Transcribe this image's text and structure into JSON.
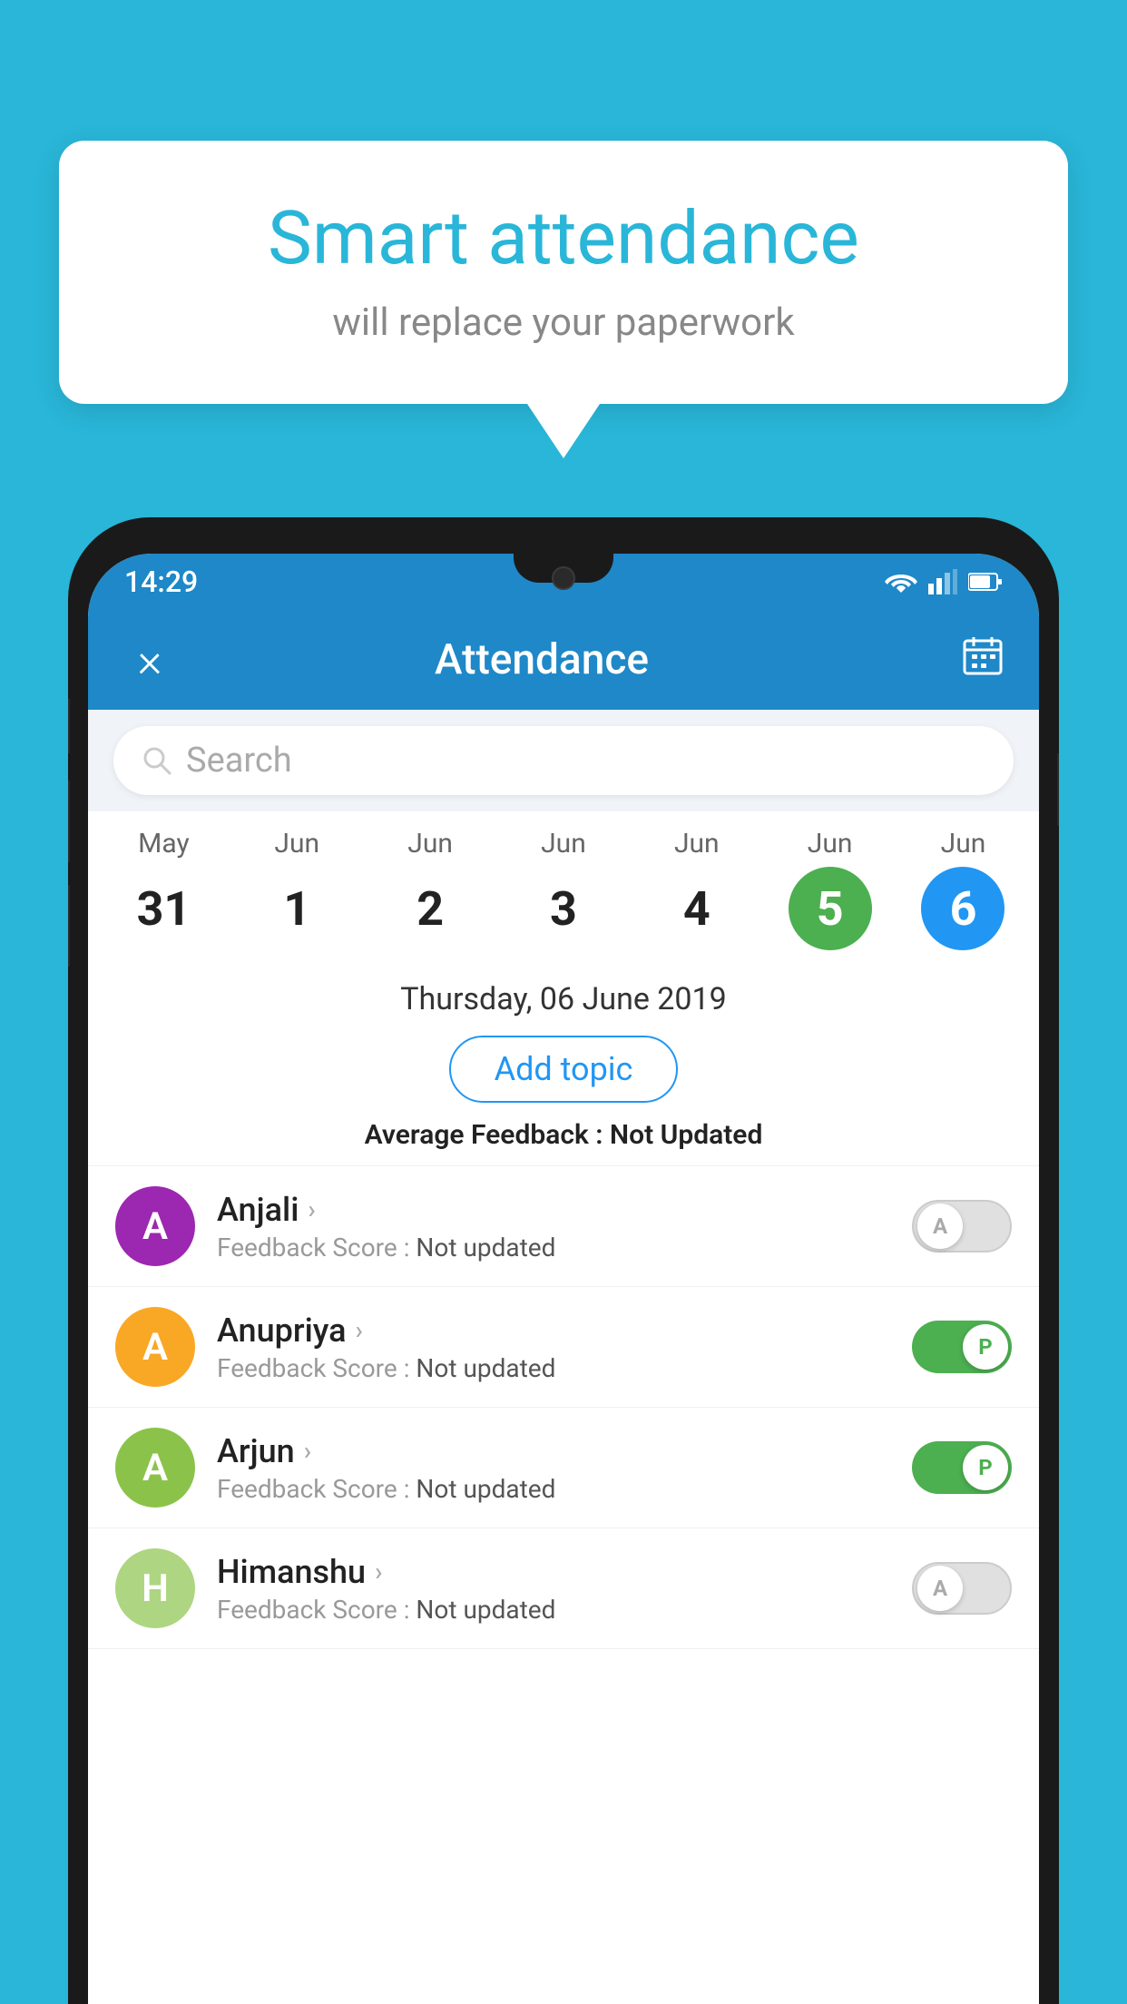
{
  "background_color": "#29b6d8",
  "speech_bubble": {
    "title": "Smart attendance",
    "subtitle": "will replace your paperwork"
  },
  "status_bar": {
    "time": "14:29"
  },
  "app_bar": {
    "title": "Attendance",
    "close_label": "×"
  },
  "search": {
    "placeholder": "Search"
  },
  "calendar": {
    "days": [
      {
        "month": "May",
        "date": "31",
        "selected": false
      },
      {
        "month": "Jun",
        "date": "1",
        "selected": false
      },
      {
        "month": "Jun",
        "date": "2",
        "selected": false
      },
      {
        "month": "Jun",
        "date": "3",
        "selected": false
      },
      {
        "month": "Jun",
        "date": "4",
        "selected": false
      },
      {
        "month": "Jun",
        "date": "5",
        "selected": "green"
      },
      {
        "month": "Jun",
        "date": "6",
        "selected": "blue"
      }
    ]
  },
  "date_info": {
    "date_text": "Thursday, 06 June 2019",
    "add_topic_label": "Add topic",
    "avg_feedback_label": "Average Feedback : ",
    "avg_feedback_value": "Not Updated"
  },
  "students": [
    {
      "name": "Anjali",
      "initial": "A",
      "avatar_color": "#9c27b0",
      "feedback_label": "Feedback Score : ",
      "feedback_value": "Not updated",
      "toggle_state": "off",
      "toggle_label": "A"
    },
    {
      "name": "Anupriya",
      "initial": "A",
      "avatar_color": "#f9a825",
      "feedback_label": "Feedback Score : ",
      "feedback_value": "Not updated",
      "toggle_state": "on",
      "toggle_label": "P"
    },
    {
      "name": "Arjun",
      "initial": "A",
      "avatar_color": "#8bc34a",
      "feedback_label": "Feedback Score : ",
      "feedback_value": "Not updated",
      "toggle_state": "on",
      "toggle_label": "P"
    },
    {
      "name": "Himanshu",
      "initial": "H",
      "avatar_color": "#aed581",
      "feedback_label": "Feedback Score : ",
      "feedback_value": "Not updated",
      "toggle_state": "off",
      "toggle_label": "A"
    }
  ]
}
